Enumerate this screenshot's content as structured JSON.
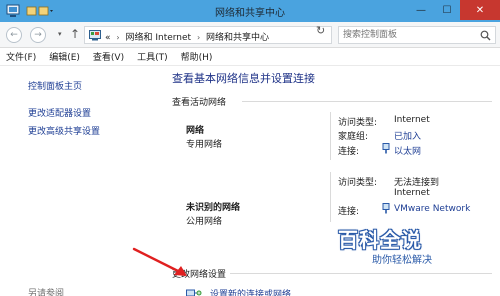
{
  "window": {
    "title": "网络和共享中心",
    "controls": {
      "minimize": "—",
      "maximize": "☐",
      "close": "✕"
    }
  },
  "address": {
    "back_icon": "back-arrow-icon",
    "forward_icon": "forward-arrow-icon",
    "up_icon": "up-arrow-icon",
    "overflow": "«",
    "breadcrumbs": [
      "网络和 Internet",
      "网络和共享中心"
    ],
    "search_placeholder": "搜索控制面板"
  },
  "menu": [
    "文件(F)",
    "编辑(E)",
    "查看(V)",
    "工具(T)",
    "帮助(H)"
  ],
  "sidebar": {
    "links": [
      "控制面板主页",
      "更改适配器设置",
      "更改高级共享设置"
    ],
    "see_also": "另请参阅"
  },
  "main": {
    "title": "查看基本网络信息并设置连接",
    "active_networks_label": "查看活动网络",
    "networks": [
      {
        "name": "网络",
        "type": "专用网络",
        "access_type_label": "访问类型:",
        "access_type": "Internet",
        "homegroup_label": "家庭组:",
        "homegroup": "已加入",
        "connection_label": "连接:",
        "connection": "以太网"
      },
      {
        "name": "未识别的网络",
        "type": "公用网络",
        "access_type_label": "访问类型:",
        "access_type_line1": "无法连接到",
        "access_type_line2": "Internet",
        "connection_label": "连接:",
        "connection": "VMware Network"
      }
    ],
    "change_settings_label": "更改网络设置",
    "setup_link": "设置新的连接或网络"
  },
  "watermark": {
    "brand": "百科全说",
    "slogan": "助你轻松解决"
  },
  "colors": {
    "titlebar": "#4aa3df",
    "close_button": "#c7372f",
    "link": "#1e3e94",
    "annotation_arrow": "#e02020"
  }
}
